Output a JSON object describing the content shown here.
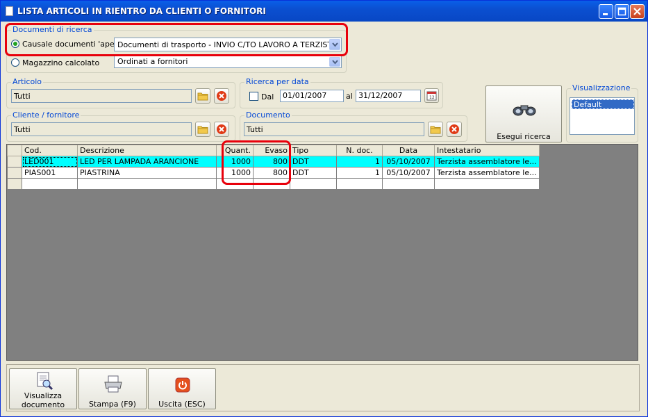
{
  "window": {
    "title": "LISTA ARTICOLI IN RIENTRO DA CLIENTI O FORNITORI"
  },
  "documenti_ricerca": {
    "legend": "Documenti di ricerca",
    "radio_causale_label": "Causale documenti 'aperti'",
    "causale_value": "Documenti di trasporto - INVIO C/TO LAVORO A TERZISTA",
    "radio_magazzino_label": "Magazzino calcolato",
    "magazzino_value": "Ordinati a fornitori"
  },
  "articolo": {
    "legend": "Articolo",
    "value": "Tutti"
  },
  "ricerca_data": {
    "legend": "Ricerca per data",
    "dal_label": "Dal",
    "from_date": "01/01/2007",
    "al_label": "al",
    "to_date": "31/12/2007"
  },
  "esegui": {
    "label": "Esegui ricerca"
  },
  "visualizzazione": {
    "legend": "Visualizzazione",
    "selected": "Default"
  },
  "cliente_fornitore": {
    "legend": "Cliente / fornitore",
    "value": "Tutti"
  },
  "documento": {
    "legend": "Documento",
    "value": "Tutti"
  },
  "grid": {
    "columns": [
      "Cod.",
      "Descrizione",
      "Quant.",
      "Evaso",
      "Tipo",
      "N. doc.",
      "Data",
      "Intestatario"
    ],
    "rows": [
      [
        "LED001",
        "LED PER LAMPADA ARANCIONE",
        "1000",
        "800",
        "DDT",
        "1",
        "05/10/2007",
        "Terzista assemblatore le..."
      ],
      [
        "PIAS001",
        "PIASTRINA",
        "1000",
        "800",
        "DDT",
        "1",
        "05/10/2007",
        "Terzista assemblatore le..."
      ]
    ]
  },
  "bottom": {
    "visualizza_label_1": "Visualizza",
    "visualizza_label_2": "documento",
    "stampa_label": "Stampa (F9)",
    "uscita_label": "Uscita (ESC)"
  },
  "colors": {
    "titlebar": "#0b4fd0",
    "legend": "#0046d5",
    "highlight_row": "#00ffff",
    "annotation": "#e8000b"
  }
}
